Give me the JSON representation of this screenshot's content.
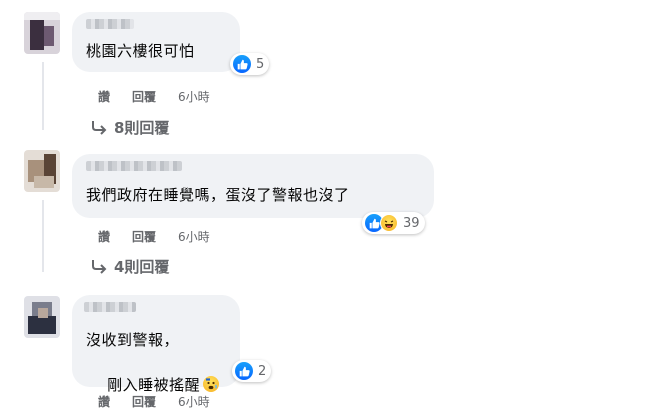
{
  "comments": [
    {
      "text": "桃園六樓很可怕",
      "reaction_count": "5",
      "like_label": "讚",
      "reply_label": "回覆",
      "time": "6小時",
      "replies_link": "8則回覆"
    },
    {
      "text": "我們政府在睡覺嗎，蛋沒了警報也沒了",
      "reaction_count": "39",
      "like_label": "讚",
      "reply_label": "回覆",
      "time": "6小時",
      "replies_link": "4則回覆"
    },
    {
      "text_line1": "沒收到警報，",
      "text_line2": "剛入睡被搖醒",
      "reaction_count": "2",
      "like_label": "讚",
      "reply_label": "回覆",
      "time": "6小時"
    }
  ],
  "icons": {
    "like": "like-icon",
    "haha": "haha-icon",
    "reply_arrow": "reply-arrow-icon",
    "anxious_emoji": "anxious-face-emoji"
  },
  "colors": {
    "bubble": "#f0f2f5",
    "like_blue": "#0866ff",
    "secondary_text": "#65676b"
  }
}
